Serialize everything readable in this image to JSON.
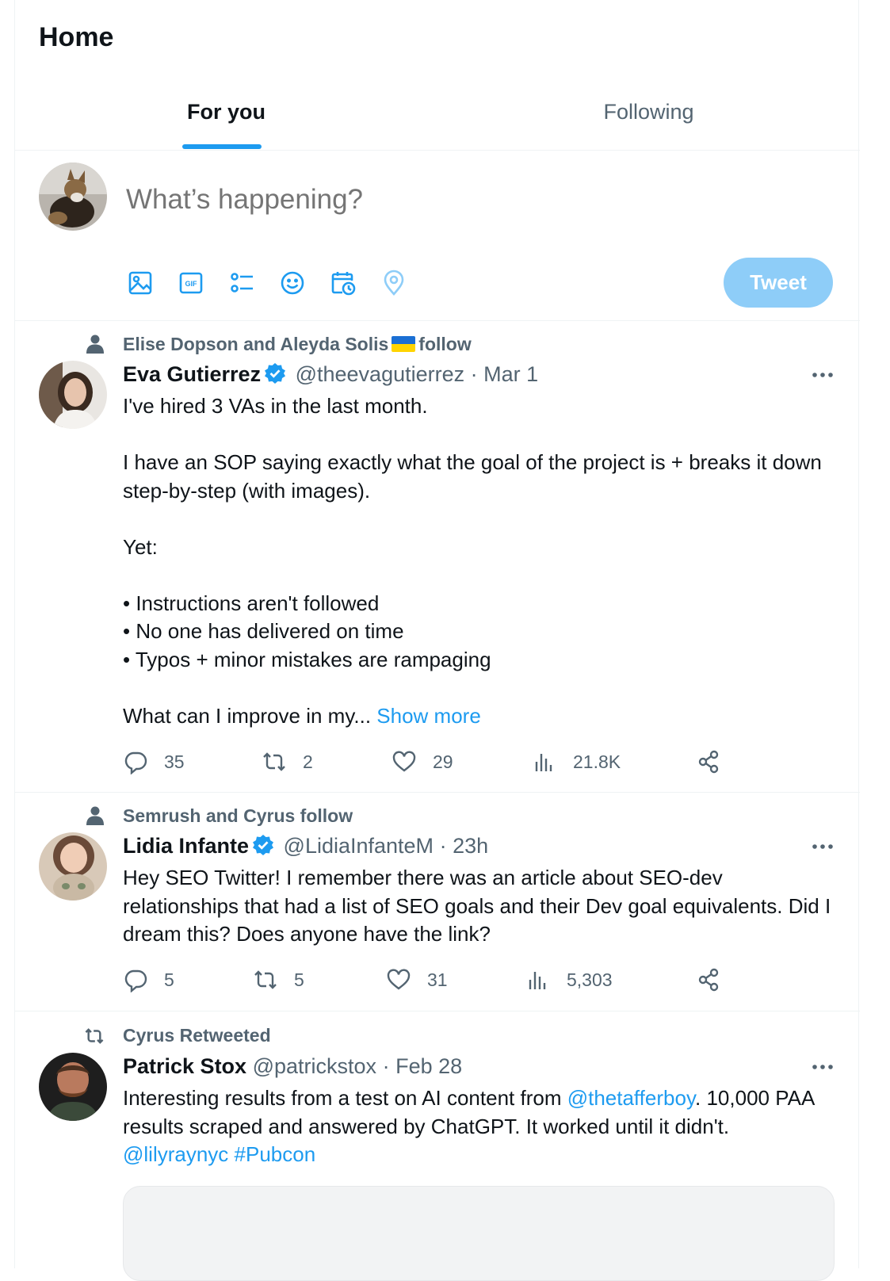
{
  "header": {
    "title": "Home"
  },
  "tabs": [
    {
      "label": "For you",
      "active": true
    },
    {
      "label": "Following",
      "active": false
    }
  ],
  "composer": {
    "placeholder": "What’s happening?",
    "tools": [
      "image-icon",
      "gif-icon",
      "poll-icon",
      "emoji-icon",
      "schedule-icon",
      "location-icon"
    ],
    "tweet_button": "Tweet"
  },
  "tweets": [
    {
      "context_prefix": "Elise Dopson and Aleyda Solis",
      "context_suffix": "follow",
      "name": "Eva Gutierrez",
      "verified": true,
      "handle": "@theevagutierrez",
      "dot": "·",
      "time": "Mar 1",
      "text": "I've hired 3 VAs in the last month.\n\nI have an SOP saying exactly what the goal of the project is + breaks it down step-by-step (with images).\n\nYet:\n\n• Instructions aren't followed\n• No one has delivered on time\n• Typos + minor mistakes are rampaging\n\nWhat can I improve in my... ",
      "show_more": "Show more",
      "replies": "35",
      "retweets": "2",
      "likes": "29",
      "views": "21.8K"
    },
    {
      "context": "Semrush and Cyrus follow",
      "name": "Lidia Infante",
      "verified": true,
      "handle": "@LidiaInfanteM",
      "dot": "·",
      "time": "23h",
      "text": "Hey SEO Twitter! I remember there was an article about SEO-dev relationships that had a list of SEO goals and their Dev goal equivalents. Did I dream this? Does anyone have the link?",
      "replies": "5",
      "retweets": "5",
      "likes": "31",
      "views": "5,303"
    },
    {
      "context": "Cyrus Retweeted",
      "name": "Patrick Stox",
      "verified": false,
      "handle": "@patrickstox",
      "dot": "·",
      "time": "Feb 28",
      "text_part1": "Interesting results from a test on AI content from ",
      "mention1": "@thetafferboy",
      "text_part2": ". 10,000 PAA results scraped and answered by ChatGPT. It worked until it didn't.",
      "mention2": "@lilyraynyc",
      "hashtag": "#Pubcon"
    }
  ],
  "colors": {
    "accent": "#1d9bf0",
    "muted": "#536471",
    "text": "#0f1419",
    "tweet_button_disabled": "#8ecdf8"
  }
}
